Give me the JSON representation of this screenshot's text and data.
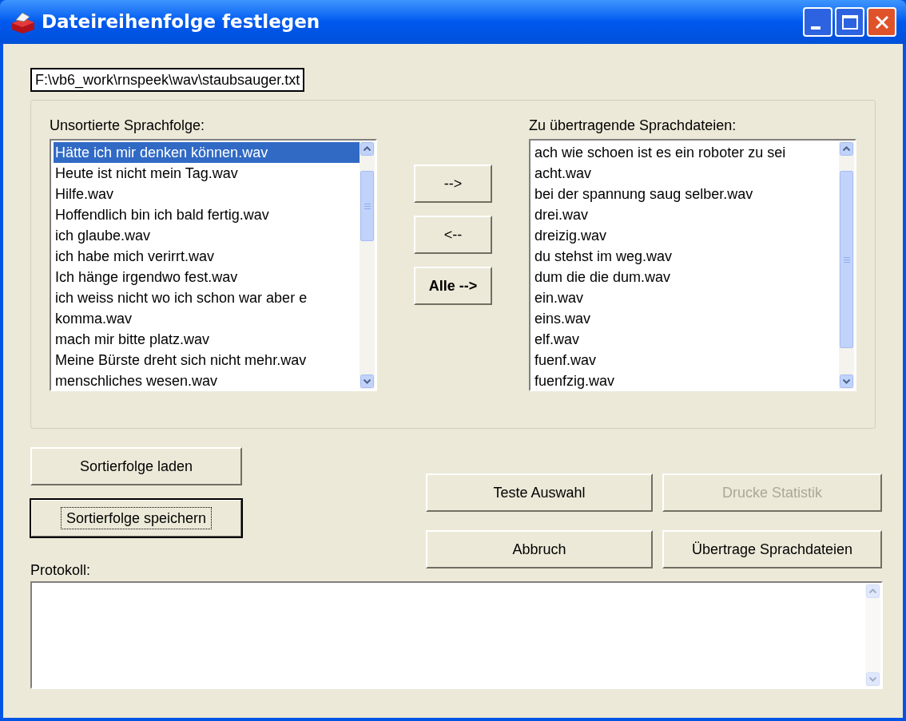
{
  "window": {
    "title": "Dateireihenfolge festlegen"
  },
  "path_field": {
    "value": "F:\\vb6_work\\rnspeek\\wav\\staubsauger.txt"
  },
  "source_list": {
    "label": "Unsortierte Sprachfolge:",
    "items": [
      {
        "text": "Hätte ich mir denken können.wav",
        "selected": true
      },
      {
        "text": "Heute ist nicht mein Tag.wav",
        "selected": false
      },
      {
        "text": "Hilfe.wav",
        "selected": false
      },
      {
        "text": "Hoffendlich bin ich bald fertig.wav",
        "selected": false
      },
      {
        "text": "ich glaube.wav",
        "selected": false
      },
      {
        "text": "ich habe mich verirrt.wav",
        "selected": false
      },
      {
        "text": "Ich hänge irgendwo fest.wav",
        "selected": false
      },
      {
        "text": "ich weiss nicht wo ich schon war aber e",
        "selected": false
      },
      {
        "text": "komma.wav",
        "selected": false
      },
      {
        "text": "mach mir bitte platz.wav",
        "selected": false
      },
      {
        "text": "Meine Bürste dreht sich nicht mehr.wav",
        "selected": false
      },
      {
        "text": "menschliches wesen.wav",
        "selected": false
      }
    ]
  },
  "transfer_buttons": [
    {
      "label": "-->",
      "bold": false
    },
    {
      "label": "<--",
      "bold": false
    },
    {
      "label": "Alle -->",
      "bold": true
    }
  ],
  "target_list": {
    "label": "Zu übertragende Sprachdateien:",
    "items": [
      {
        "text": "ach wie schoen ist es ein roboter zu sei",
        "selected": false
      },
      {
        "text": "acht.wav",
        "selected": false
      },
      {
        "text": "bei der spannung saug selber.wav",
        "selected": false
      },
      {
        "text": "drei.wav",
        "selected": false
      },
      {
        "text": "dreizig.wav",
        "selected": false
      },
      {
        "text": "du stehst im weg.wav",
        "selected": false
      },
      {
        "text": "dum die die dum.wav",
        "selected": false
      },
      {
        "text": "ein.wav",
        "selected": false
      },
      {
        "text": "eins.wav",
        "selected": false
      },
      {
        "text": "elf.wav",
        "selected": false
      },
      {
        "text": "fuenf.wav",
        "selected": false
      },
      {
        "text": "fuenfzig.wav",
        "selected": false
      }
    ]
  },
  "sort_buttons": [
    {
      "label": "Sortierfolge laden",
      "focused": false
    },
    {
      "label": "Sortierfolge speichern",
      "focused": true
    }
  ],
  "action_buttons": [
    {
      "label": "Teste Auswahl",
      "disabled": false
    },
    {
      "label": "Drucke Statistik",
      "disabled": true
    },
    {
      "label": "Abbruch",
      "disabled": false
    },
    {
      "label": "Übertrage Sprachdateien",
      "disabled": false
    }
  ],
  "log": {
    "label": "Protokoll:"
  }
}
